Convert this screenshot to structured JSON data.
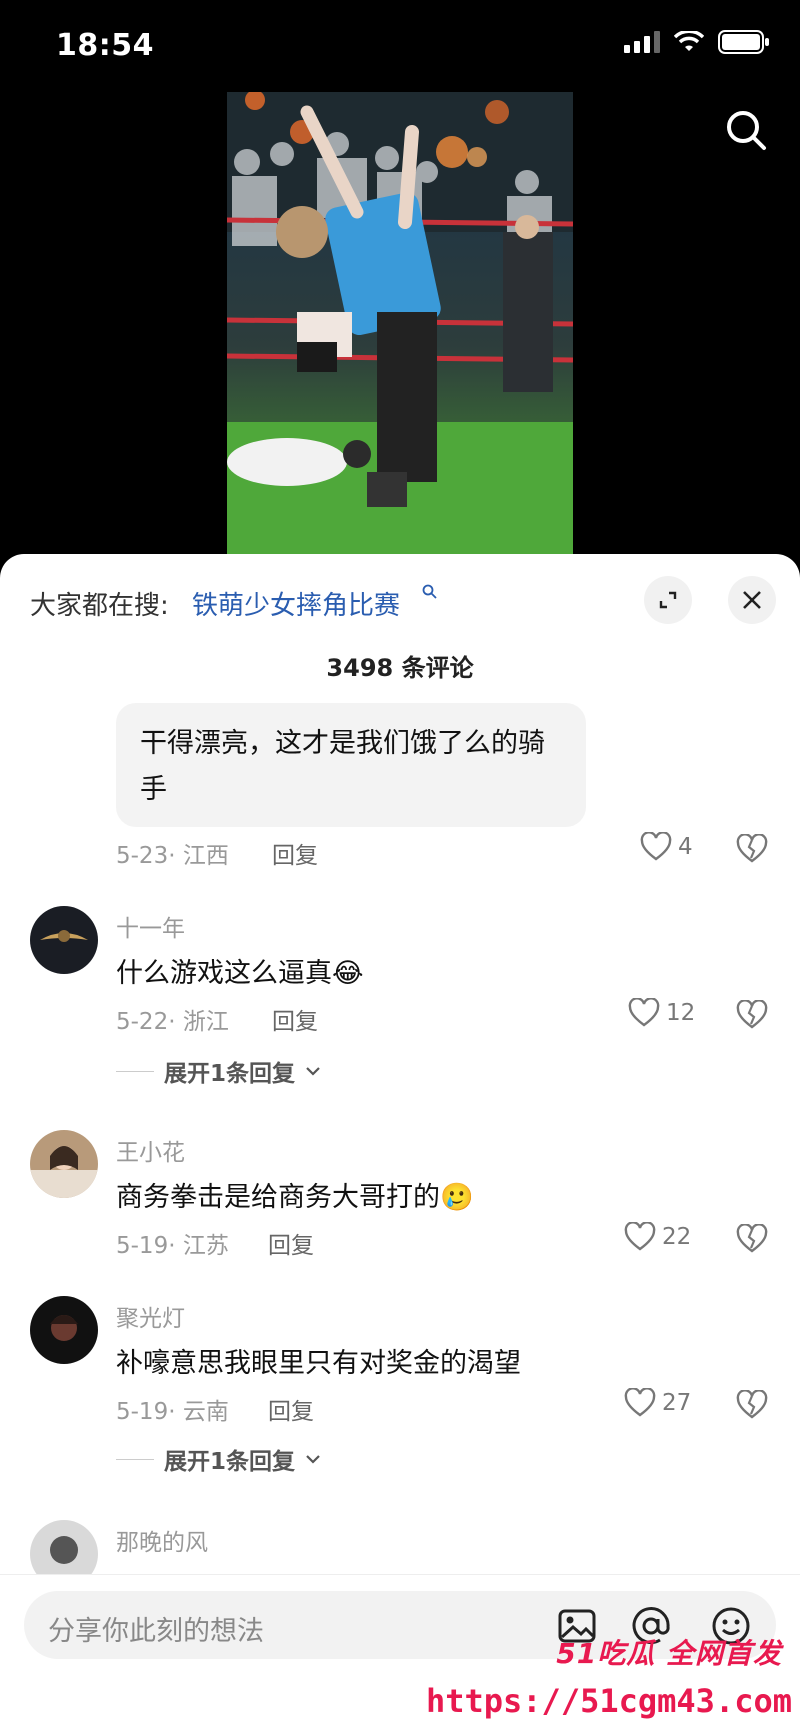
{
  "status_bar": {
    "time": "18:54"
  },
  "sheet": {
    "search_hint_prefix": "大家都在搜:",
    "search_hint_query": "铁萌少女摔角比赛",
    "comment_count": "3498 条评论"
  },
  "comments": [
    {
      "text": "干得漂亮，这才是我们饿了么的骑手",
      "date_location": "5-23· 江西",
      "reply": "回复",
      "likes": "4"
    },
    {
      "user": "十一年",
      "text": "什么游戏这么逼真",
      "emoji": "😂",
      "date_location": "5-22· 浙江",
      "reply": "回复",
      "likes": "12",
      "expand": "展开1条回复"
    },
    {
      "user": "王小花",
      "text": "商务拳击是给商务大哥打的",
      "emoji": "🥲",
      "date_location": "5-19· 江苏",
      "reply": "回复",
      "likes": "22"
    },
    {
      "user": "聚光灯",
      "text": "补嚎意思我眼里只有对奖金的渴望",
      "date_location": "5-19· 云南",
      "reply": "回复",
      "likes": "27",
      "expand": "展开1条回复"
    },
    {
      "user": "那晚的风"
    }
  ],
  "input": {
    "placeholder": "分享你此刻的想法"
  },
  "watermark": {
    "line1": "51吃瓜 全网首发",
    "line2": "https://51cgm43.com"
  },
  "colors": {
    "link": "#2a5db0",
    "watermark": "#e8194f"
  },
  "icons": [
    "signal-icon",
    "wifi-icon",
    "battery-icon",
    "search-icon",
    "expand-icon",
    "close-icon",
    "heart-icon",
    "dislike-heart-icon",
    "chevron-down-icon",
    "image-icon",
    "at-icon",
    "emoji-icon"
  ]
}
